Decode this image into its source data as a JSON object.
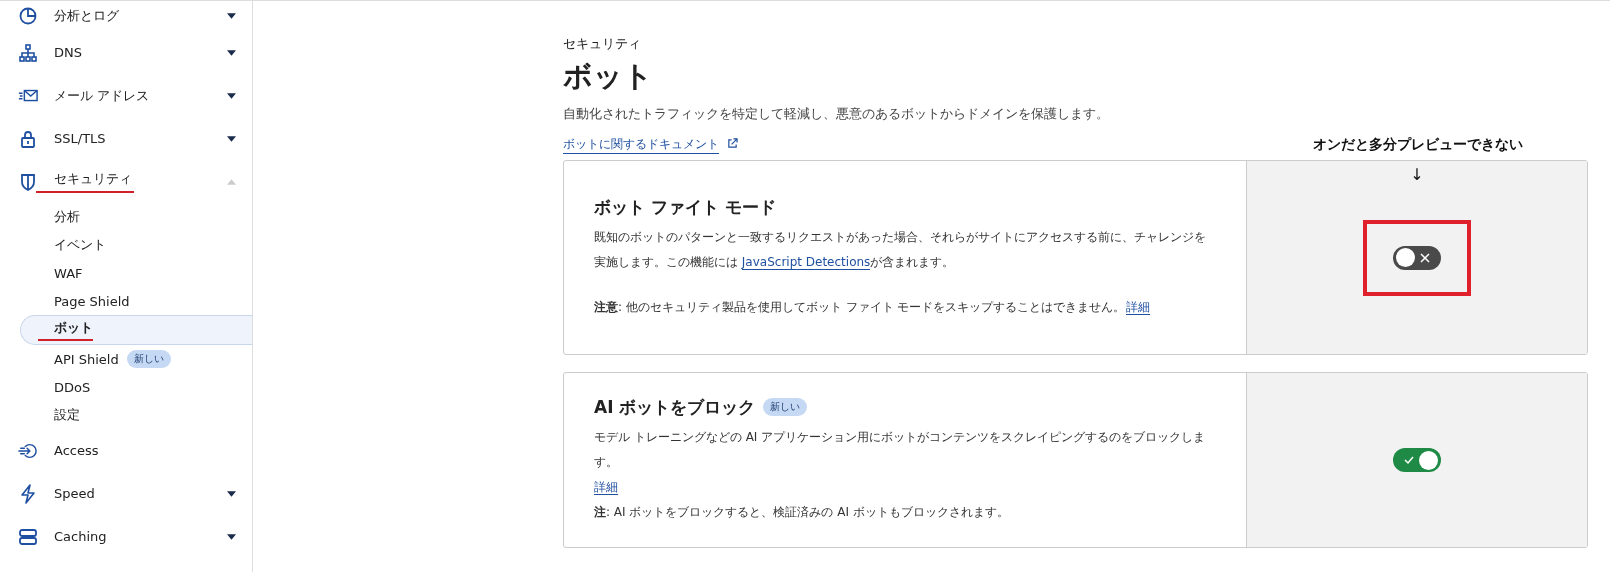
{
  "sidebar": {
    "items": [
      {
        "kind": "pie",
        "label": "分析とログ",
        "expanded": false,
        "underlined": false
      },
      {
        "kind": "sitemap",
        "label": "DNS",
        "expanded": false,
        "underlined": false
      },
      {
        "kind": "mail",
        "label": "メール アドレス",
        "expanded": false,
        "underlined": false
      },
      {
        "kind": "lock",
        "label": "SSL/TLS",
        "expanded": false,
        "underlined": false
      },
      {
        "kind": "shield",
        "label": "セキュリティ",
        "expanded": true,
        "underlined": true,
        "children": [
          {
            "label": "分析",
            "selected": false,
            "underlined": false
          },
          {
            "label": "イベント",
            "selected": false,
            "underlined": false
          },
          {
            "label": "WAF",
            "selected": false,
            "underlined": false
          },
          {
            "label": "Page Shield",
            "selected": false,
            "underlined": false
          },
          {
            "label": "ボット",
            "selected": true,
            "underlined": true
          },
          {
            "label": "API Shield",
            "selected": false,
            "underlined": false,
            "badge": "新しい"
          },
          {
            "label": "DDoS",
            "selected": false,
            "underlined": false
          },
          {
            "label": "設定",
            "selected": false,
            "underlined": false
          }
        ]
      },
      {
        "kind": "access",
        "label": "Access",
        "underlined": false
      },
      {
        "kind": "bolt",
        "label": "Speed",
        "expanded": false,
        "underlined": false
      },
      {
        "kind": "caching",
        "label": "Caching",
        "expanded": false,
        "underlined": false
      }
    ]
  },
  "page": {
    "breadcrumb": "セキュリティ",
    "title": "ボット",
    "description": "自動化されたトラフィックを特定して軽減し、悪意のあるボットからドメインを保護します。",
    "doc_link": "ボットに関するドキュメント"
  },
  "annotation": {
    "text": "オンだと多分プレビューできない",
    "arrow": "↓"
  },
  "cards": [
    {
      "title": "ボット ファイト モード",
      "on": false,
      "highlighted": true,
      "paragraphs": [
        [
          {
            "parts": [
              {
                "text": "既知のボットのパターンと一致するリクエストがあった場合、それらがサイトにアクセスする前に、チャレンジを実施します。この機能には "
              },
              {
                "text": "JavaScript Detections",
                "link": true
              },
              {
                "text": "が含まれます。"
              }
            ]
          }
        ],
        [
          {
            "parts": [
              {
                "text": "**注意**: 他のセキュリティ製品を使用してボット ファイト モードをスキップすることはできません。"
              },
              {
                "text": "詳細",
                "link": true
              }
            ]
          }
        ]
      ]
    },
    {
      "title": "AI ボットをブロック",
      "badge": "新しい",
      "on": true,
      "highlighted": false,
      "paragraphs": [
        [
          {
            "parts": [
              {
                "text": "モデル トレーニングなどの AI アプリケーション用にボットがコンテンツをスクレイピングするのをブロックします。"
              }
            ]
          },
          {
            "parts": [
              {
                "text": "詳細",
                "link": true
              }
            ]
          },
          {
            "parts": [
              {
                "text": "**注**: AI ボットをブロックすると、検証済みの AI ボットもブロックされます。"
              }
            ]
          }
        ]
      ]
    }
  ]
}
